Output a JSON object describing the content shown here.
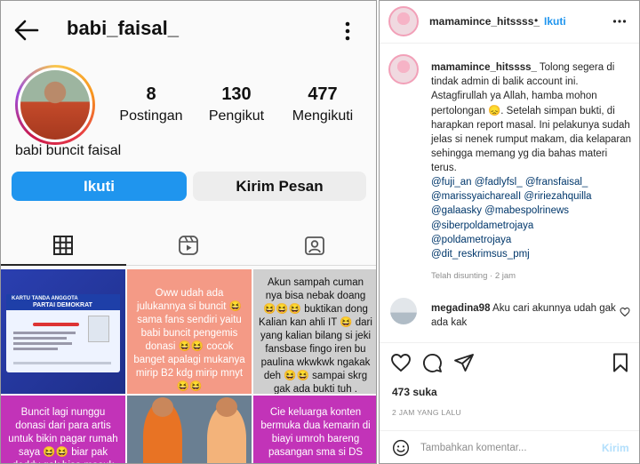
{
  "profile": {
    "username": "babi_faisal_",
    "display_name": "babi buncit faisal",
    "stats": [
      {
        "value": "8",
        "label": "Postingan"
      },
      {
        "value": "130",
        "label": "Pengikut"
      },
      {
        "value": "477",
        "label": "Mengikuti"
      }
    ],
    "follow_label": "Ikuti",
    "message_label": "Kirim Pesan"
  },
  "grid": {
    "tiles": [
      {
        "card_title_1": "KARTU TANDA ANGGOTA",
        "card_title_2": "PARTAI DEMOKRAT"
      },
      {
        "text": "Oww udah ada julukannya si buncit 😆 sama fans sendiri yaitu babi buncit pengemis donasi 😆😆 cocok banget apalagi mukanya mirip B2 kdg mirip mnyt 😆😆"
      },
      {
        "text": "Akun sampah cuman nya bisa nebak doang 😆😆😆 buktikan dong Kalian kan ahli IT 😆 dari yang kalian bilang si jeki fansbase fingo iren bu paulina wkwkwk ngakak deh 😆😆 sampai skrg gak ada bukti tuh ."
      },
      {
        "text": "Buncit lagi nunggu donasi dari para artis untuk bikin pagar rumah saya 😆😆 biar pak doddy gak bisa masuk"
      },
      {
        "text": ""
      },
      {
        "text": "Cie keluarga konten bermuka dua kemarin di biayi umroh bareng pasangan sma si DS"
      }
    ]
  },
  "post": {
    "author": "mamamince_hitssss_",
    "separator": "•",
    "follow_label": "Ikuti",
    "caption": "Tolong segera di tindak admin di balik account ini. Astagfirullah ya Allah, hamba mohon pertolongan 😞. Setelah simpan bukti, di harapkan report masal. Ini pelakunya sudah jelas si nenek rumput makam, dia kelaparan sehingga memang yg dia bahas materi terus.",
    "mentions": [
      "@fuji_an @fadlyfsl_ @fransfaisal_",
      "@marissyaicharealI @ririezahquilla",
      "@galaasky @mabespolrinews",
      "@siberpoldametrojaya",
      "@poldametrojaya",
      "@dit_reskrimsus_pmj"
    ],
    "edited": "Telah disunting · 2 jam",
    "comment_user": "megadina98",
    "comment_text": "Aku cari akunnya udah gak ada kak",
    "likes": "473 suka",
    "timestamp": "2 JAM YANG LALU",
    "comment_placeholder": "Tambahkan komentar...",
    "post_label": "Kirim"
  },
  "icons": {
    "back": "back-arrow-icon",
    "more": "more-vertical-icon",
    "grid": "grid-icon",
    "reels": "reels-icon",
    "tagged": "tagged-icon",
    "like": "heart-icon",
    "comment": "comment-icon",
    "share": "share-icon",
    "save": "bookmark-icon",
    "emoji": "emoji-icon"
  },
  "colors": {
    "follow_blue": "#1f95ee",
    "mention_blue": "#00376b",
    "tile_pink": "#c233b8",
    "tile_salmon": "#f49a86"
  }
}
